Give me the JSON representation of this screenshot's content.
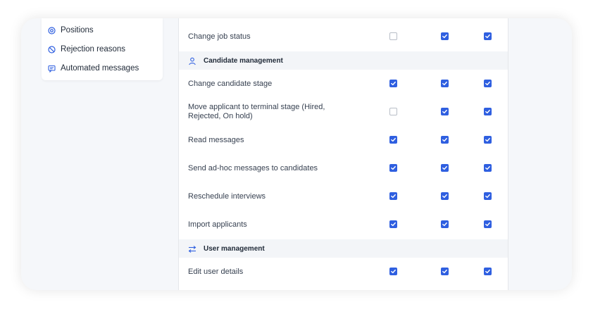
{
  "colors": {
    "accent": "#2f5fe0",
    "section_bg": "#f3f5f8",
    "page_bg": "#f5f7fa"
  },
  "sidebar": {
    "items": [
      {
        "label": "Positions",
        "icon": "target-icon"
      },
      {
        "label": "Rejection reasons",
        "icon": "ban-icon"
      },
      {
        "label": "Automated messages",
        "icon": "chat-icon"
      }
    ]
  },
  "permissions": {
    "job_rows": [
      {
        "label": "Change job status",
        "checks": [
          false,
          true,
          true
        ]
      }
    ],
    "candidate_section": {
      "title": "Candidate management",
      "icon": "users-icon"
    },
    "candidate_rows": [
      {
        "label": "Change candidate stage",
        "checks": [
          true,
          true,
          true
        ]
      },
      {
        "label": "Move applicant to terminal stage (Hired, Rejected, On hold)",
        "line1": "Move applicant to terminal stage (Hired,",
        "line2": "Rejected, On hold)",
        "checks": [
          false,
          true,
          true
        ]
      },
      {
        "label": "Read messages",
        "checks": [
          true,
          true,
          true
        ]
      },
      {
        "label": "Send ad-hoc messages to candidates",
        "checks": [
          true,
          true,
          true
        ]
      },
      {
        "label": "Reschedule interviews",
        "checks": [
          true,
          true,
          true
        ]
      },
      {
        "label": "Import applicants",
        "checks": [
          true,
          true,
          true
        ]
      }
    ],
    "user_section": {
      "title": "User management",
      "icon": "arrows-swap-icon"
    },
    "user_rows": [
      {
        "label": "Edit user details",
        "checks": [
          true,
          true,
          true
        ]
      }
    ]
  }
}
